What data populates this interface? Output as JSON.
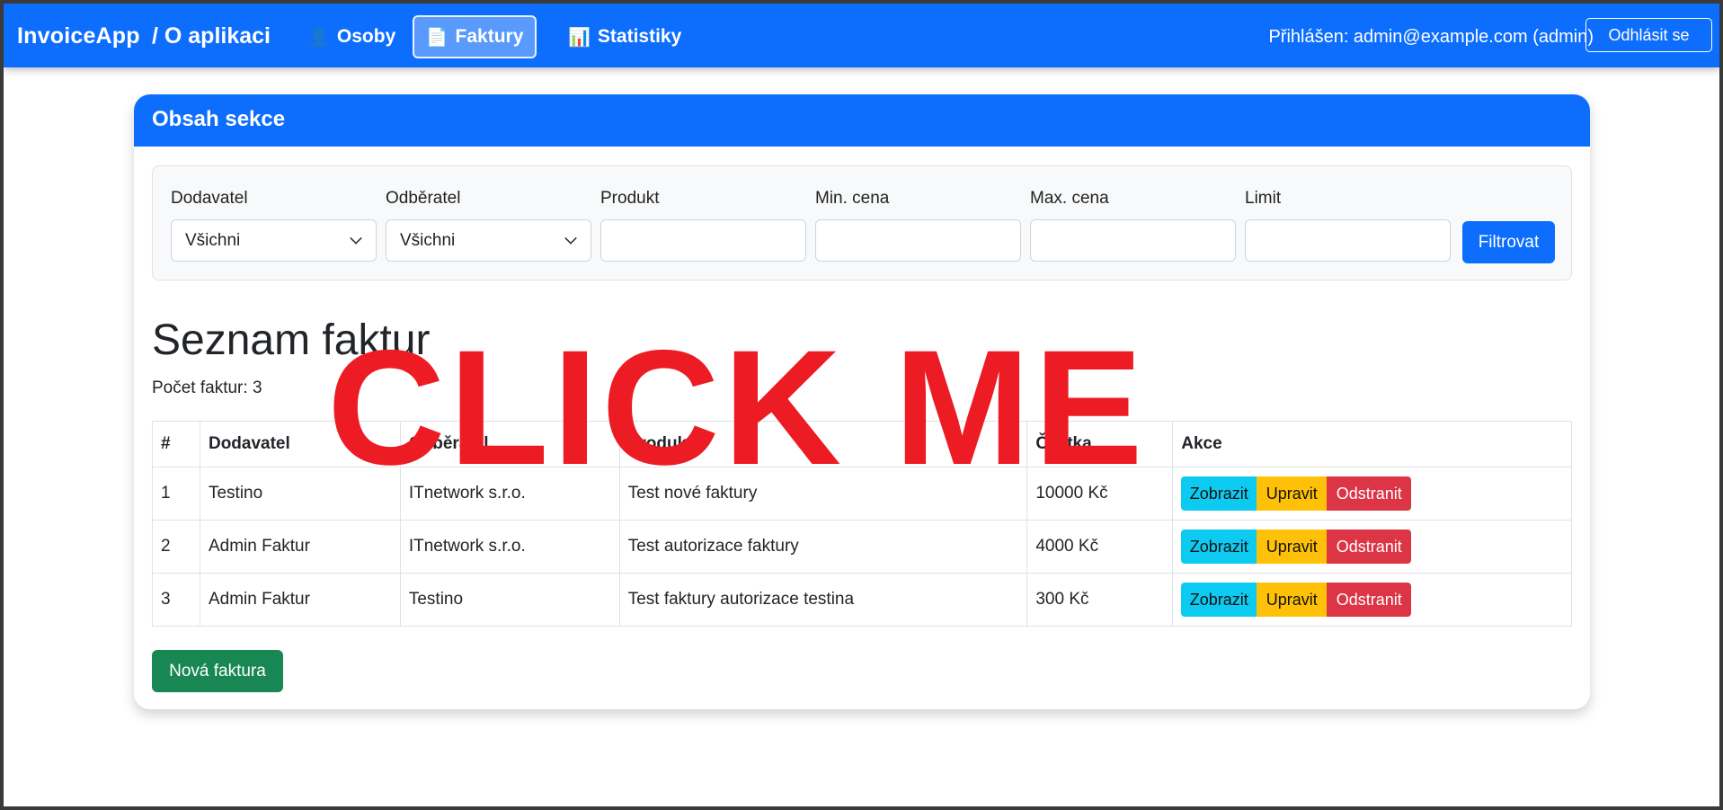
{
  "navbar": {
    "brand": "InvoiceApp",
    "about": "/ O aplikaci",
    "items": [
      {
        "label": "Osoby",
        "icon": "👤"
      },
      {
        "label": "Faktury",
        "icon": "📄"
      },
      {
        "label": "Statistiky",
        "icon": "📊"
      }
    ],
    "login_text": "Přihlášen: admin@example.com (admin)",
    "logout_label": "Odhlásit se"
  },
  "card": {
    "header": "Obsah sekce"
  },
  "filters": {
    "supplier_label": "Dodavatel",
    "supplier_value": "Všichni",
    "customer_label": "Odběratel",
    "customer_value": "Všichni",
    "product_label": "Produkt",
    "min_label": "Min. cena",
    "max_label": "Max. cena",
    "limit_label": "Limit",
    "submit_label": "Filtrovat"
  },
  "list": {
    "title": "Seznam faktur",
    "count": "Počet faktur: 3",
    "headers": [
      "#",
      "Dodavatel",
      "Odběratel",
      "Produkt",
      "Částka",
      "Akce"
    ],
    "rows": [
      {
        "id": "1",
        "supplier": "Testino",
        "customer": "ITnetwork s.r.o.",
        "product": "Test nové faktury",
        "amount": "10000 Kč"
      },
      {
        "id": "2",
        "supplier": "Admin Faktur",
        "customer": "ITnetwork s.r.o.",
        "product": "Test autorizace faktury",
        "amount": "4000 Kč"
      },
      {
        "id": "3",
        "supplier": "Admin Faktur",
        "customer": "Testino",
        "product": "Test faktury autorizace testina",
        "amount": "300 Kč"
      }
    ],
    "actions": {
      "view": "Zobrazit",
      "edit": "Upravit",
      "delete": "Odstranit"
    },
    "new_label": "Nová faktura"
  },
  "overlay_text": "CLICK ME"
}
